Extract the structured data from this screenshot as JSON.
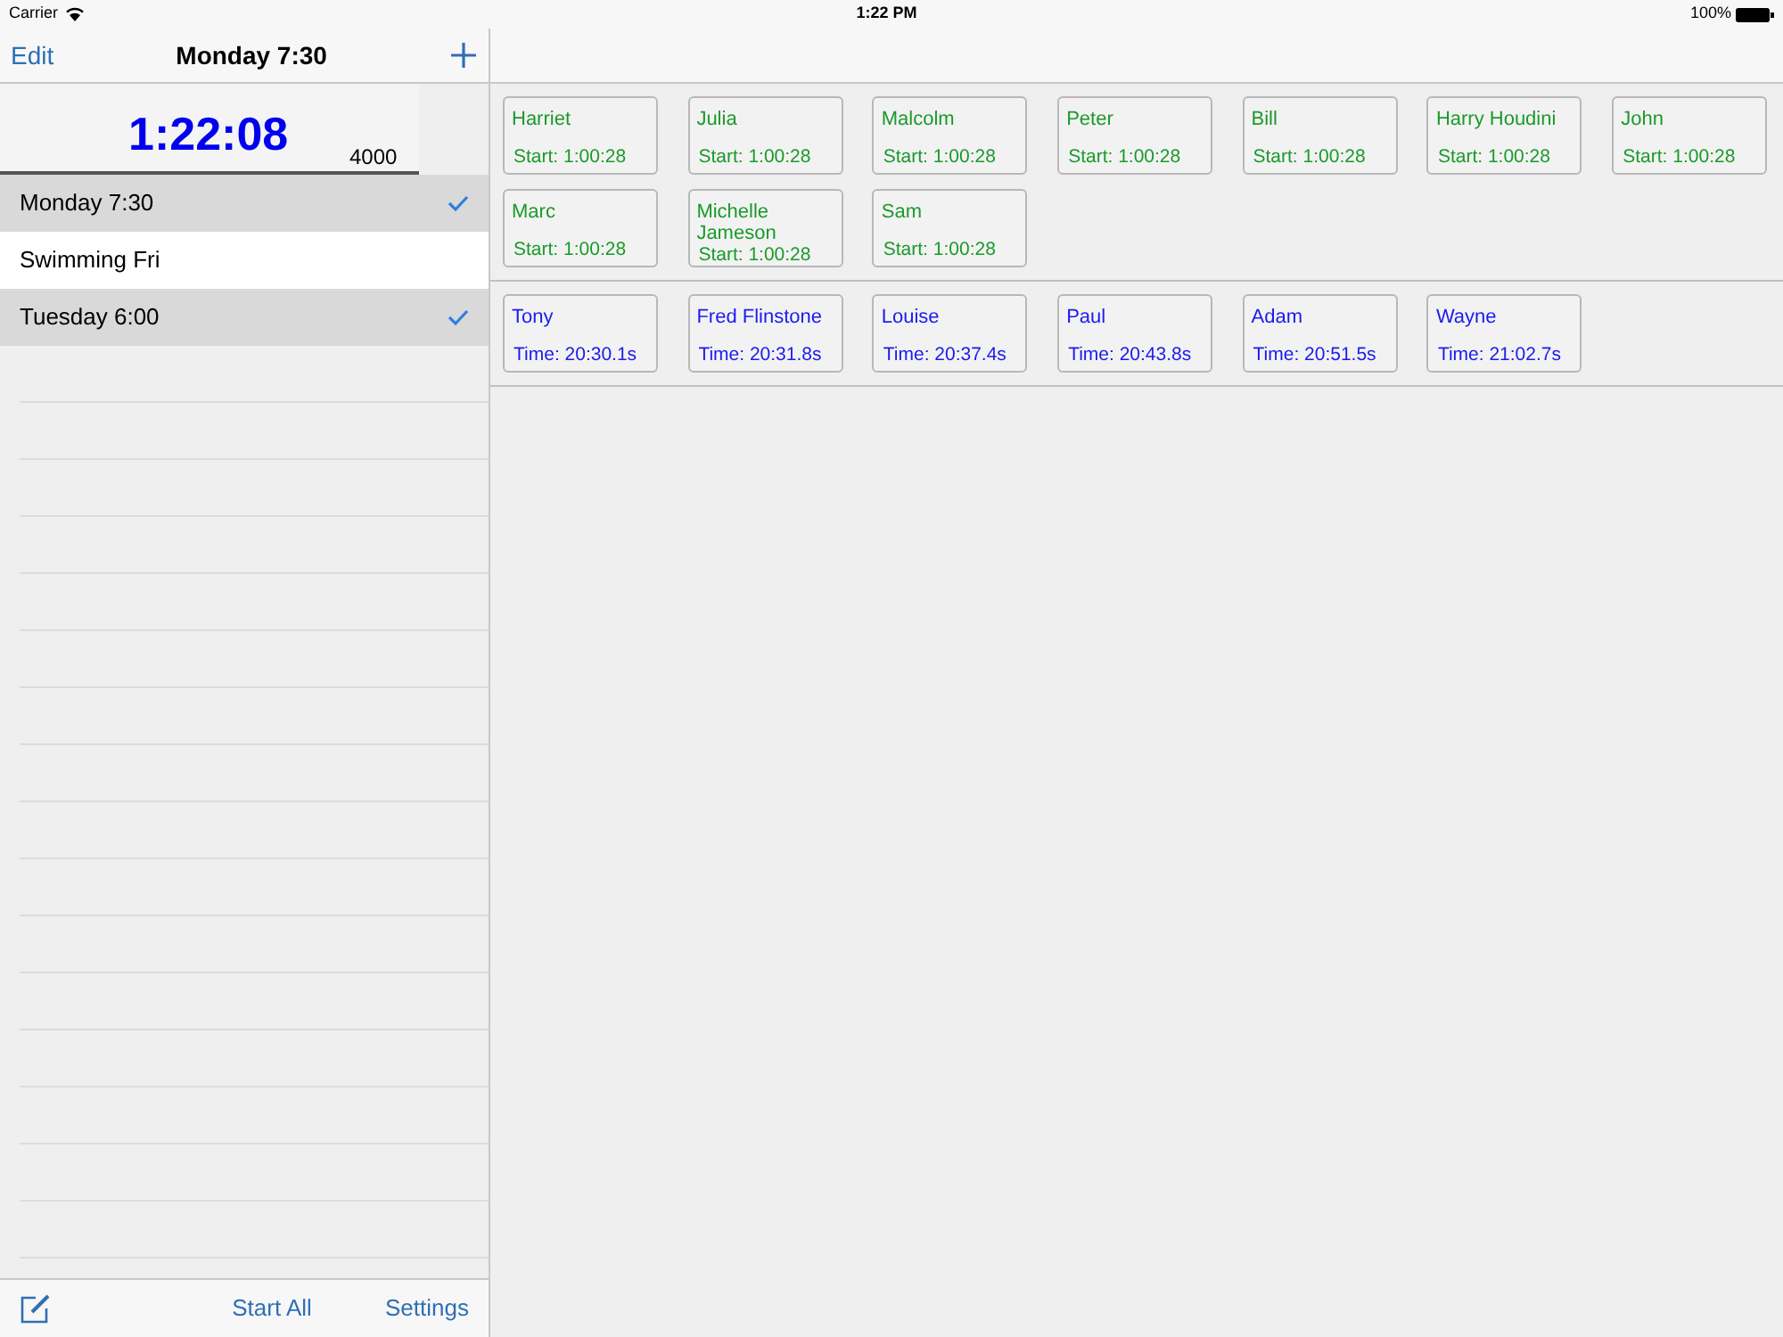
{
  "status_bar": {
    "carrier": "Carrier",
    "time": "1:22 PM",
    "battery": "100%"
  },
  "nav": {
    "left": "Edit",
    "title": "Monday 7:30"
  },
  "timer": {
    "time": "1:22:08",
    "distance": "4000"
  },
  "sessions": [
    {
      "label": "Monday 7:30",
      "checked": true
    },
    {
      "label": "Swimming Fri",
      "checked": false
    },
    {
      "label": "Tuesday 6:00",
      "checked": true
    }
  ],
  "toolbar": {
    "center": "Start All",
    "right": "Settings"
  },
  "sections": [
    {
      "kind": "running",
      "cards": [
        {
          "name": "Harriet",
          "detail": "Start: 1:00:28"
        },
        {
          "name": "Julia",
          "detail": "Start: 1:00:28"
        },
        {
          "name": "Malcolm",
          "detail": "Start: 1:00:28"
        },
        {
          "name": "Peter",
          "detail": "Start: 1:00:28"
        },
        {
          "name": "Bill",
          "detail": "Start: 1:00:28"
        },
        {
          "name": "Harry Houdini",
          "detail": "Start: 1:00:28"
        },
        {
          "name": "John",
          "detail": "Start: 1:00:28"
        },
        {
          "name": "Marc",
          "detail": "Start: 1:00:28"
        },
        {
          "name": "Michelle Jameson",
          "detail": "Start: 1:00:28"
        },
        {
          "name": "Sam",
          "detail": "Start: 1:00:28"
        }
      ]
    },
    {
      "kind": "finished",
      "cards": [
        {
          "name": "Tony",
          "detail": "Time: 20:30.1s"
        },
        {
          "name": "Fred Flinstone",
          "detail": "Time: 20:31.8s"
        },
        {
          "name": "Louise",
          "detail": "Time: 20:37.4s"
        },
        {
          "name": "Paul",
          "detail": "Time: 20:43.8s"
        },
        {
          "name": "Adam",
          "detail": "Time: 20:51.5s"
        },
        {
          "name": "Wayne",
          "detail": "Time: 21:02.7s"
        }
      ]
    }
  ]
}
